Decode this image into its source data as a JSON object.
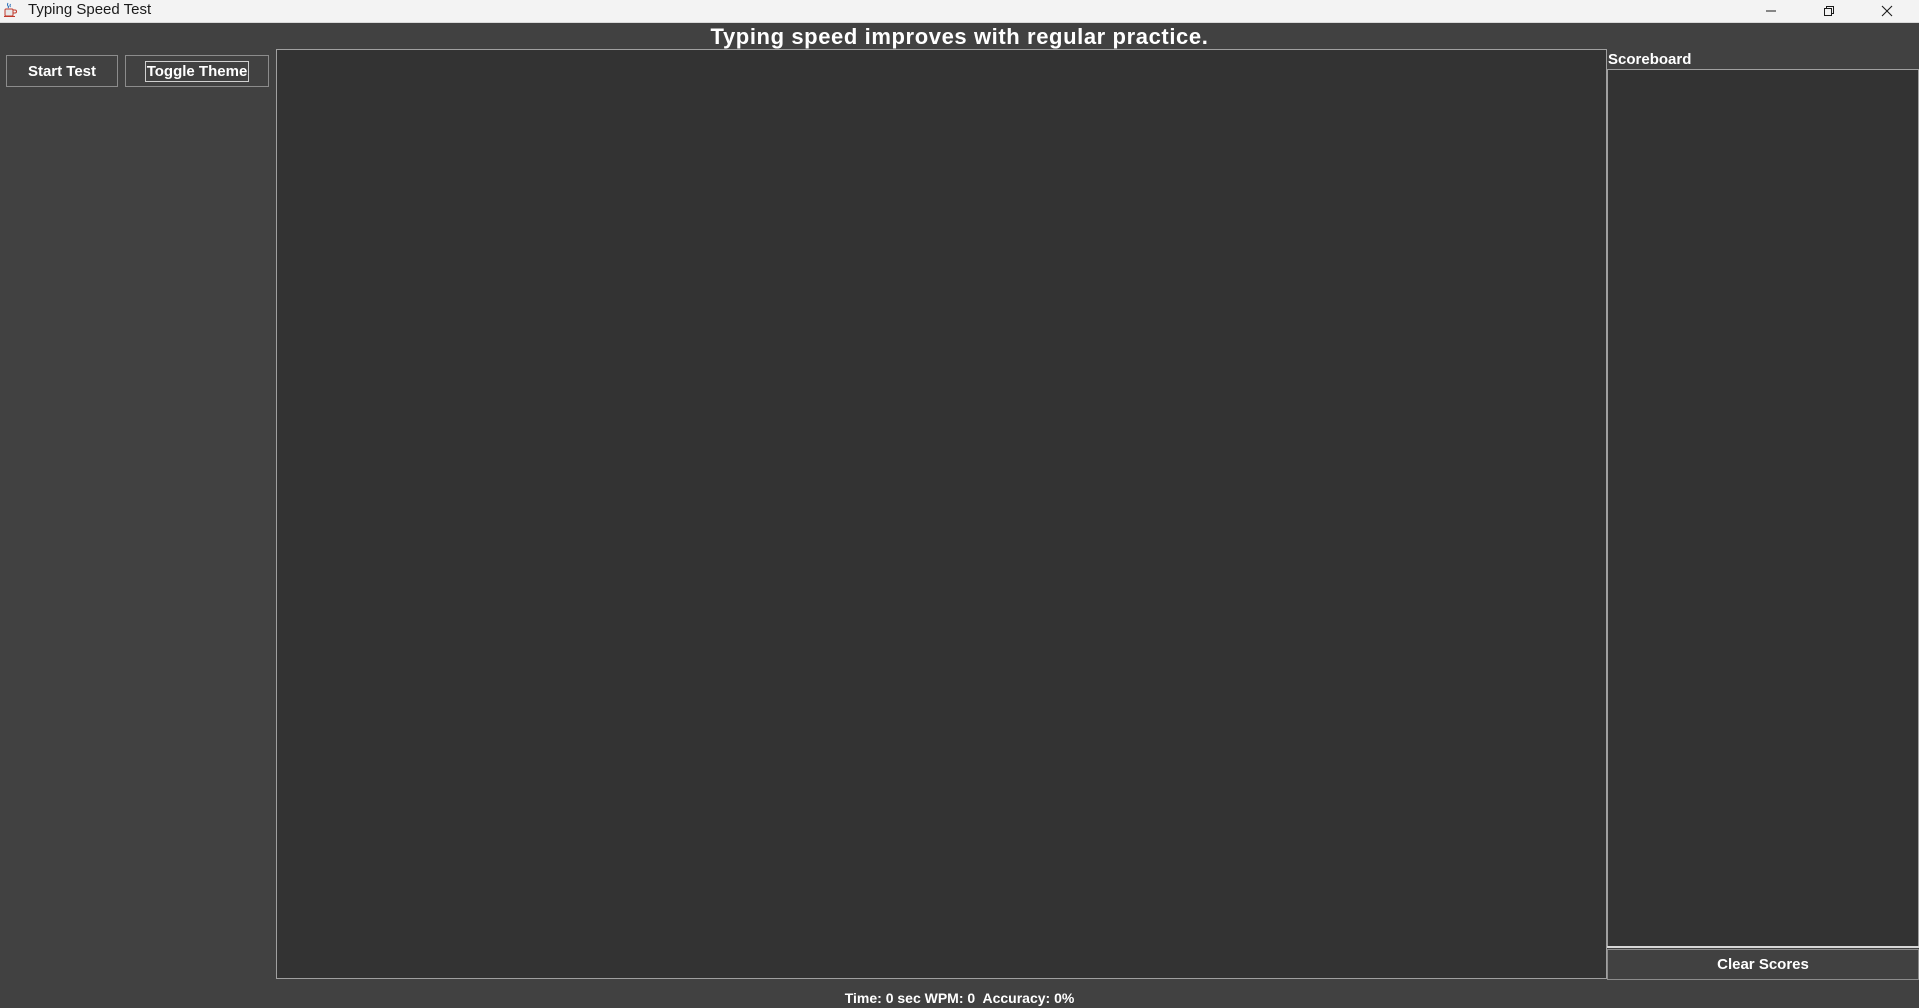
{
  "window": {
    "title": "Typing Speed Test",
    "icon": "java-cup-icon",
    "controls": [
      "minimize-icon",
      "restore-icon",
      "close-icon"
    ]
  },
  "heading": {
    "sentence": "Typing speed improves with regular practice."
  },
  "toolbar": {
    "start_label": "Start Test",
    "theme_label": "Toggle Theme"
  },
  "typing_area": {
    "value": ""
  },
  "scoreboard": {
    "title": "Scoreboard",
    "scores": [],
    "clear_label": "Clear Scores"
  },
  "status": {
    "time_label": "Time:",
    "time_value": "0",
    "time_unit": "sec",
    "wpm_label": "WPM:",
    "wpm_value": "0",
    "accuracy_label": "Accuracy:",
    "accuracy_value": "0%"
  },
  "colors": {
    "background": "#414141",
    "text_area": "#333333",
    "text": "#ffffff",
    "title_bar": "#f3f3f3"
  }
}
